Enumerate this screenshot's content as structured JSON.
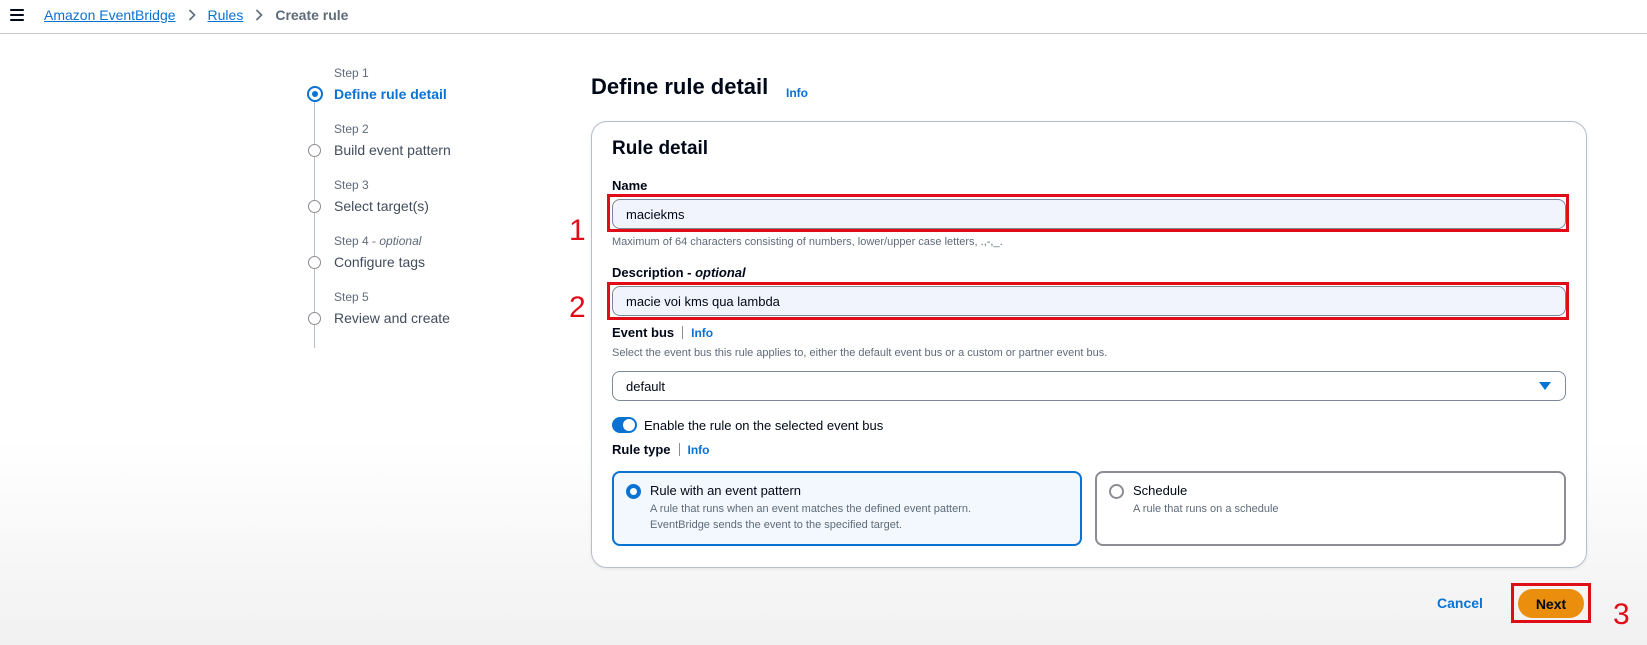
{
  "breadcrumb": {
    "items": [
      "Amazon EventBridge",
      "Rules"
    ],
    "current": "Create rule"
  },
  "steps": [
    {
      "number": "Step 1",
      "title": "Define rule detail",
      "active": true
    },
    {
      "number": "Step 2",
      "title": "Build event pattern",
      "active": false
    },
    {
      "number": "Step 3",
      "title": "Select target(s)",
      "active": false
    },
    {
      "number": "Step 4",
      "optional": "optional",
      "title": "Configure tags",
      "active": false
    },
    {
      "number": "Step 5",
      "title": "Review and create",
      "active": false
    }
  ],
  "page": {
    "title": "Define rule detail",
    "info": "Info"
  },
  "rule_detail": {
    "header": "Rule detail",
    "name_label": "Name",
    "name_value": "maciekms",
    "name_hint": "Maximum of 64 characters consisting of numbers, lower/upper case letters, .,-,_.",
    "description_label": "Description - ",
    "description_optional": "optional",
    "description_value": "macie voi kms qua lambda",
    "event_bus_label": "Event bus",
    "event_bus_info": "Info",
    "event_bus_hint": "Select the event bus this rule applies to, either the default event bus or a custom or partner event bus.",
    "event_bus_value": "default",
    "enable_label": "Enable the rule on the selected event bus",
    "enable_on": true,
    "rule_type_label": "Rule type",
    "rule_type_info": "Info",
    "rule_types": [
      {
        "title": "Rule with an event pattern",
        "desc1": "A rule that runs when an event matches the defined event pattern.",
        "desc2": "EventBridge sends the event to the specified target.",
        "selected": true
      },
      {
        "title": "Schedule",
        "desc1": "A rule that runs on a schedule",
        "desc2": "",
        "selected": false
      }
    ]
  },
  "annotations": [
    "1",
    "2",
    "3"
  ],
  "footer": {
    "cancel": "Cancel",
    "next": "Next"
  },
  "colors": {
    "accent": "#0972d3",
    "primary_button": "#ec8e0d",
    "annotation": "#e00d19"
  }
}
